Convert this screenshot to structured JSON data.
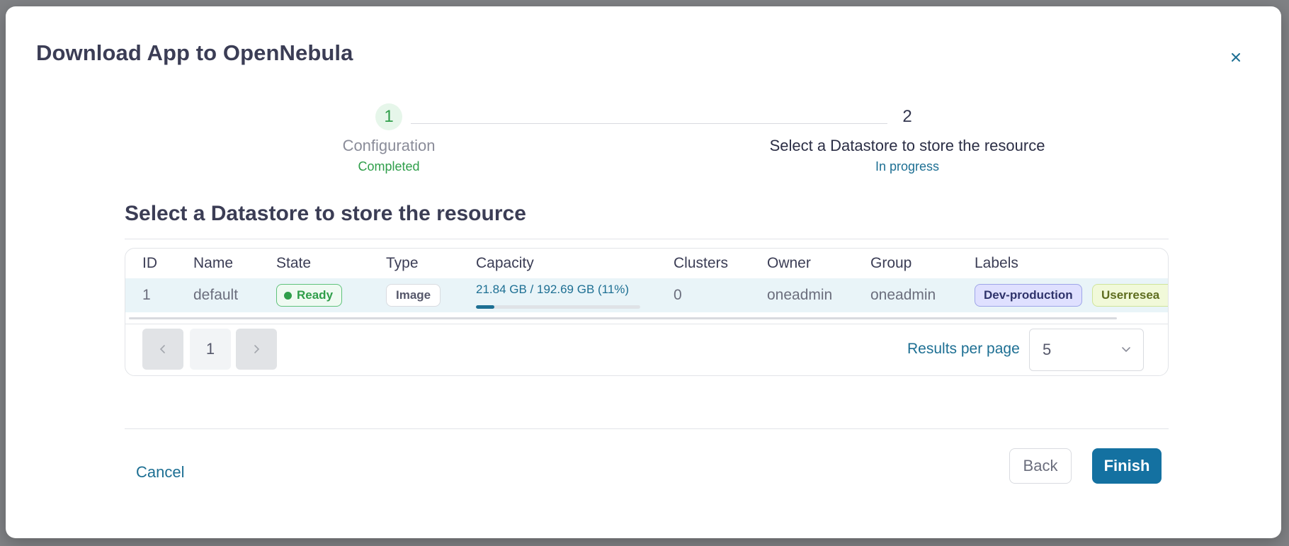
{
  "dialog": {
    "title": "Download App to OpenNebula"
  },
  "stepper": {
    "steps": [
      {
        "number": "1",
        "title": "Configuration",
        "status": "Completed"
      },
      {
        "number": "2",
        "title": "Select a Datastore to store the resource",
        "status": "In progress"
      }
    ]
  },
  "section": {
    "title": "Select a Datastore to store the resource"
  },
  "table": {
    "headers": [
      "ID",
      "Name",
      "State",
      "Type",
      "Capacity",
      "Clusters",
      "Owner",
      "Group",
      "Labels"
    ],
    "rows": [
      {
        "id": "1",
        "name": "default",
        "state": "Ready",
        "type": "Image",
        "capacity": "21.84 GB / 192.69 GB (11%)",
        "capacity_percent": 11,
        "clusters": "0",
        "owner": "oneadmin",
        "group": "oneadmin",
        "labels": [
          "Dev-production",
          "Userresea"
        ]
      }
    ]
  },
  "pagination": {
    "prev_icon": "chevron-left-icon",
    "page": "1",
    "next_icon": "chevron-right-icon",
    "results_label": "Results per page",
    "results_value": "5"
  },
  "footer": {
    "cancel": "Cancel",
    "back": "Back",
    "finish": "Finish"
  },
  "colors": {
    "accent": "#1471a1",
    "success": "#2f9e4a"
  }
}
